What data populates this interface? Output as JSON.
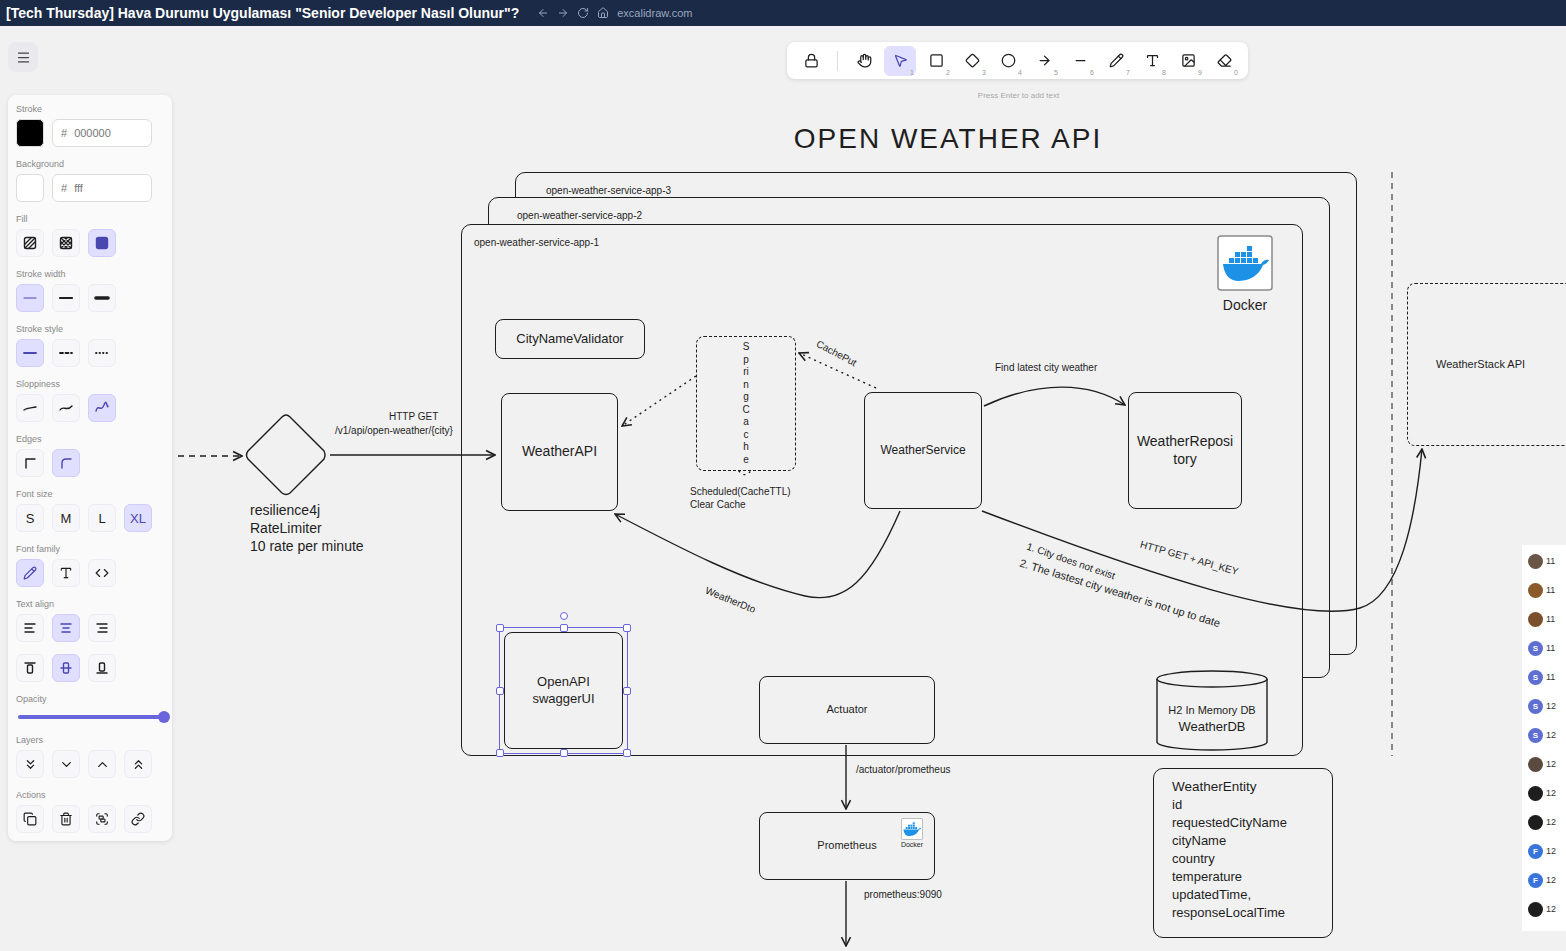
{
  "browser": {
    "title": "[Tech Thursday] Hava Durumu Uygulaması \"Senior Developer Nasıl Olunur\"?",
    "url": "excalidraw.com"
  },
  "toolbar": {
    "tools": [
      {
        "selected": false
      },
      {
        "selected": false
      },
      {
        "shortcut": "1",
        "selected": true
      },
      {
        "shortcut": "2",
        "selected": false
      },
      {
        "shortcut": "3",
        "selected": false
      },
      {
        "shortcut": "4",
        "selected": false
      },
      {
        "shortcut": "5",
        "selected": false
      },
      {
        "shortcut": "6",
        "selected": false
      },
      {
        "shortcut": "7",
        "selected": false
      },
      {
        "shortcut": "8",
        "selected": false
      },
      {
        "shortcut": "9",
        "selected": false
      },
      {
        "shortcut": "0",
        "selected": false
      }
    ],
    "hint": "Press Enter to add text"
  },
  "properties": {
    "sections": [
      {
        "label": "Stroke",
        "kind": "color",
        "hash": "#",
        "value": "000000"
      },
      {
        "label": "Background",
        "kind": "color",
        "hash": "#",
        "value": "fff"
      },
      {
        "label": "Fill",
        "kind": "icons",
        "options": [
          {
            "selected": false
          },
          {
            "selected": false
          },
          {
            "selected": true
          }
        ]
      },
      {
        "label": "Stroke width",
        "kind": "icons",
        "options": [
          {
            "selected": true
          },
          {
            "selected": false
          },
          {
            "selected": false
          }
        ]
      },
      {
        "label": "Stroke style",
        "kind": "icons",
        "options": [
          {
            "selected": true
          },
          {
            "selected": false
          },
          {
            "selected": false
          }
        ]
      },
      {
        "label": "Sloppiness",
        "kind": "icons",
        "options": [
          {
            "selected": false
          },
          {
            "selected": false
          },
          {
            "selected": true
          }
        ]
      },
      {
        "label": "Edges",
        "kind": "icons",
        "options": [
          {
            "selected": false
          },
          {
            "selected": true
          }
        ]
      },
      {
        "label": "Font size",
        "kind": "text",
        "options": [
          {
            "label": "S",
            "selected": false
          },
          {
            "label": "M",
            "selected": false
          },
          {
            "label": "L",
            "selected": false
          },
          {
            "label": "XL",
            "selected": true
          }
        ]
      },
      {
        "label": "Font family",
        "kind": "icons",
        "options": [
          {
            "selected": true
          },
          {
            "selected": false
          },
          {
            "selected": false
          }
        ]
      },
      {
        "label": "Text align",
        "kind": "icons",
        "options": [
          {
            "selected": false
          },
          {
            "selected": true
          },
          {
            "selected": false
          }
        ]
      },
      {
        "kind": "icons",
        "options": [
          {
            "selected": false
          },
          {
            "selected": true
          },
          {
            "selected": false
          }
        ]
      },
      {
        "label": "Opacity",
        "kind": "slider",
        "level": 1
      },
      {
        "label": "Layers",
        "kind": "icons",
        "options": [
          {
            "selected": false
          },
          {
            "selected": false
          },
          {
            "selected": false
          },
          {
            "selected": false
          }
        ]
      },
      {
        "label": "Actions",
        "kind": "icons",
        "options": [
          {
            "selected": false
          },
          {
            "selected": false
          },
          {
            "selected": false
          },
          {
            "selected": false
          }
        ]
      }
    ]
  },
  "diagram": {
    "title": "OPEN WEATHER API",
    "containers": [
      "open-weather-service-app-3",
      "open-weather-service-app-2",
      "open-weather-service-app-1"
    ],
    "logo": {
      "label": "Docker"
    },
    "gateway": {
      "lines": [
        "resilience4j",
        "RateLimiter",
        "10 rate per minute"
      ]
    },
    "boxes": [
      {
        "label": "CityNameValidator",
        "kind": "solid",
        "selected": false
      },
      {
        "label": "WeatherAPI",
        "kind": "solid",
        "selected": false
      },
      {
        "label": "Spring Cache",
        "kind": "dashed",
        "selected": false
      },
      {
        "label": "WeatherService",
        "kind": "solid",
        "selected": false
      },
      {
        "label": "WeatherRepository",
        "kind": "solid",
        "selected": false
      },
      {
        "label": "OpenAPI swaggerUI",
        "kind": "solid",
        "selected": true
      },
      {
        "label": "Actuator",
        "kind": "solid",
        "selected": false
      },
      {
        "label": "Prometheus",
        "kind": "solid",
        "selected": false,
        "badge": "Docker"
      },
      {
        "label": "WeatherStack API",
        "kind": "dashed",
        "selected": false
      }
    ],
    "database": {
      "lines": [
        "H2 In Memory DB",
        "WeatherDB"
      ]
    },
    "entity": {
      "title": "WeatherEntity",
      "fields": [
        "id",
        "requestedCityName",
        "cityName",
        "country",
        "temperature",
        "updatedTime,",
        "responseLocalTime"
      ]
    },
    "edges": [
      {
        "kind": "dashed",
        "labels": []
      },
      {
        "kind": "solid",
        "labels": [
          "HTTP GET",
          "/v1/api/open-weather/{city}"
        ]
      },
      {
        "kind": "dotted",
        "labels": []
      },
      {
        "kind": "dotted",
        "labels": [
          "CachePut"
        ]
      },
      {
        "kind": "dotted",
        "labels": [
          "Scheduled(CacheTTL)",
          "Clear Cache"
        ]
      },
      {
        "kind": "solid",
        "labels": [
          "Find latest city weather"
        ]
      },
      {
        "kind": "solid",
        "labels": [
          "WeatherDto"
        ]
      },
      {
        "kind": "solid",
        "labels": [
          "HTTP GET + API_KEY",
          "1. City does not exist",
          "2. The lastest city weather is not up to date"
        ]
      },
      {
        "kind": "solid",
        "labels": [
          "/actuator/prometheus"
        ]
      },
      {
        "kind": "solid",
        "labels": [
          "prometheus:9090"
        ]
      }
    ]
  },
  "participants": [
    {
      "color": "#6a5646",
      "text": "11"
    },
    {
      "color": "#8a5a2b",
      "text": "11"
    },
    {
      "color": "#7a4f2a",
      "text": "11"
    },
    {
      "initial": "S",
      "color": "#5f6fd1",
      "text": "11"
    },
    {
      "initial": "S",
      "color": "#5f6fd1",
      "text": "11"
    },
    {
      "initial": "S",
      "color": "#5f6fd1",
      "text": "12"
    },
    {
      "initial": "S",
      "color": "#5f6fd1",
      "text": "12"
    },
    {
      "color": "#5a4a40",
      "text": "12"
    },
    {
      "color": "#1e1e1e",
      "text": "12"
    },
    {
      "color": "#1e1e1e",
      "text": "12"
    },
    {
      "initial": "F",
      "color": "#3a73d9",
      "text": "12"
    },
    {
      "initial": "F",
      "color": "#3a73d9",
      "text": "12"
    },
    {
      "color": "#1e1e1e",
      "text": "12"
    }
  ]
}
